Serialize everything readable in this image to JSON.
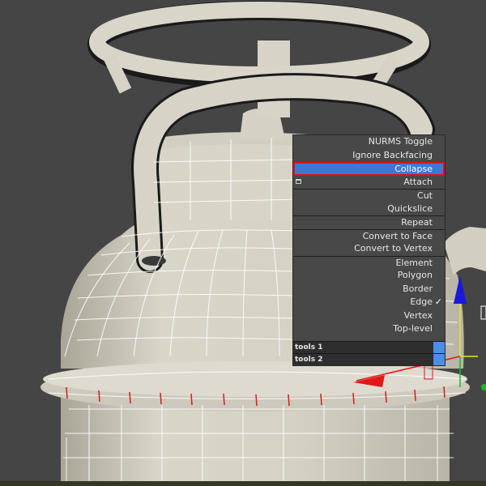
{
  "app": "3ds Max viewport",
  "colors": {
    "viewport_bg": "#454545",
    "mesh_fill": "#d6d2c6",
    "wire": "#ffffff",
    "selected_edge": "#d21c1c",
    "menu_bg": "#484848",
    "menu_text": "#e6e6e6",
    "highlight": "#3c78d6",
    "highlight_border": "#e01020",
    "gizmo_y": "#1a1ad8",
    "gizmo_x": "#e01818",
    "gizmo_z": "#10c020"
  },
  "quad_menu": {
    "items": [
      {
        "label": "NURMS Toggle"
      },
      {
        "label": "Ignore Backfacing"
      },
      {
        "label": "Collapse",
        "selected": true
      },
      {
        "label": "Attach",
        "icon": "window-icon"
      },
      {
        "label": "Cut"
      },
      {
        "label": "Quickslice"
      },
      {
        "label": "Repeat"
      },
      {
        "label": "Convert to Face"
      },
      {
        "label": "Convert to Vertex"
      },
      {
        "label": "Element"
      },
      {
        "label": "Polygon"
      },
      {
        "label": "Border"
      },
      {
        "label": "Edge",
        "checked": true
      },
      {
        "label": "Vertex"
      },
      {
        "label": "Top-level"
      }
    ],
    "quadrants": [
      "tools 1",
      "tools 2"
    ]
  }
}
